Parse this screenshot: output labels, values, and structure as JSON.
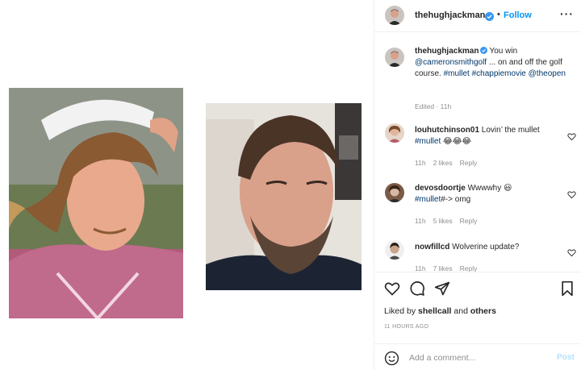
{
  "header": {
    "username": "thehughjackman",
    "separator": "•",
    "follow_label": "Follow",
    "more_label": "···"
  },
  "caption": {
    "username": "thehughjackman",
    "text_intro": "You win",
    "mention": "@cameronsmithgolf",
    "text_rest": " ... on and off the golf course. ",
    "tags": "#mullet #chappiemovie",
    "mention2": "@theopen",
    "meta": "Edited · 11h"
  },
  "comments": [
    {
      "username": "louhutchinson01",
      "text": "Lovin’ the mullet",
      "tag": "#mullet",
      "emoji": "😂😂😂",
      "time": "11h",
      "likes": "2 likes",
      "reply": "Reply"
    },
    {
      "username": "devosdoortje",
      "text": "Wwwwhy 😃",
      "tag": "#mullet",
      "text2": "#-> omg",
      "time": "11h",
      "likes": "5 likes",
      "reply": "Reply"
    },
    {
      "username": "nowfillcd",
      "text": "Wolverine update?",
      "time": "11h",
      "likes": "7 likes",
      "reply": "Reply"
    }
  ],
  "likes": {
    "prefix": "Liked by",
    "user": "shellcall",
    "mid": "and",
    "others": "others"
  },
  "timestamp": "11 HOURS AGO",
  "add_comment": {
    "placeholder": "Add a comment...",
    "post_label": "Post"
  },
  "colors": {
    "accent": "#0095f6",
    "link": "#00376b",
    "muted": "#8e8e8e",
    "post_disabled": "#b2dffc"
  }
}
